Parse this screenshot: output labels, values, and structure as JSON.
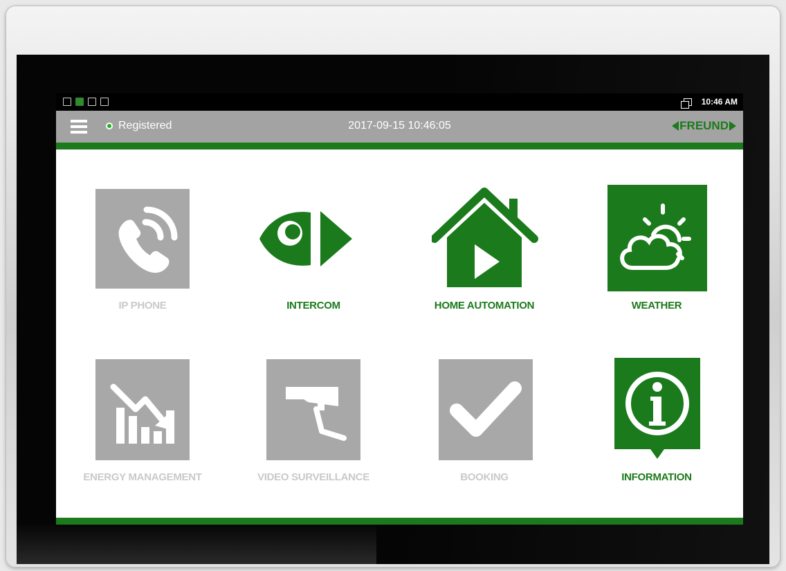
{
  "statusbar": {
    "left_icons": [
      "picture-icon",
      "app-icon",
      "mail-icon",
      "sim-icon"
    ],
    "time": "10:46 AM"
  },
  "topbar": {
    "status": "Registered",
    "datetime": "2017-09-15 10:46:05",
    "brand": "FREUND"
  },
  "tiles": [
    {
      "label": "IP PHONE",
      "icon": "phone-icon",
      "enabled": false
    },
    {
      "label": "INTERCOM",
      "icon": "eye-play-icon",
      "enabled": true
    },
    {
      "label": "HOME AUTOMATION",
      "icon": "house-play-icon",
      "enabled": true
    },
    {
      "label": "WEATHER",
      "icon": "cloud-sun-icon",
      "enabled": true
    },
    {
      "label": "ENERGY MANAGEMENT",
      "icon": "energy-chart-icon",
      "enabled": false
    },
    {
      "label": "VIDEO SURVEILLANCE",
      "icon": "camera-icon",
      "enabled": false
    },
    {
      "label": "BOOKING",
      "icon": "check-icon",
      "enabled": false
    },
    {
      "label": "INFORMATION",
      "icon": "info-icon",
      "enabled": true
    }
  ],
  "colors": {
    "accent": "#1b7a1b",
    "disabled": "#a8a8a8",
    "topbar": "#a3a3a3"
  }
}
